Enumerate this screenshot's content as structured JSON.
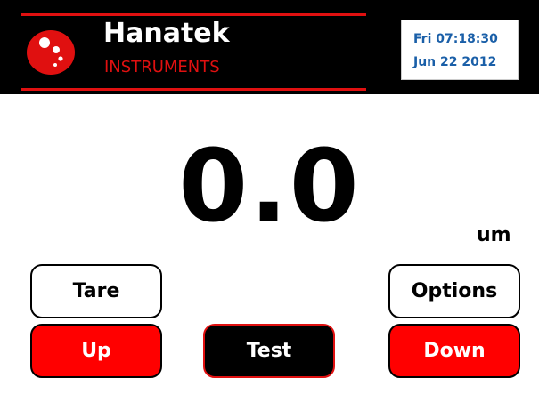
{
  "header": {
    "brand_name": "Hanatek",
    "brand_sub": "INSTRUMENTS",
    "datetime": {
      "time_line": "Fri 07:18:30",
      "date_line": "Jun 22 2012"
    }
  },
  "display": {
    "reading": "0.0",
    "unit": "um"
  },
  "buttons": {
    "tare": "Tare",
    "options": "Options",
    "up": "Up",
    "test": "Test",
    "down": "Down"
  },
  "colors": {
    "brand_red": "#e01010",
    "button_red": "#ff0000",
    "header_bg": "#000000",
    "datetime_text": "#1a5fa8"
  },
  "icons": {
    "logo": "red-circle-logo-icon"
  }
}
